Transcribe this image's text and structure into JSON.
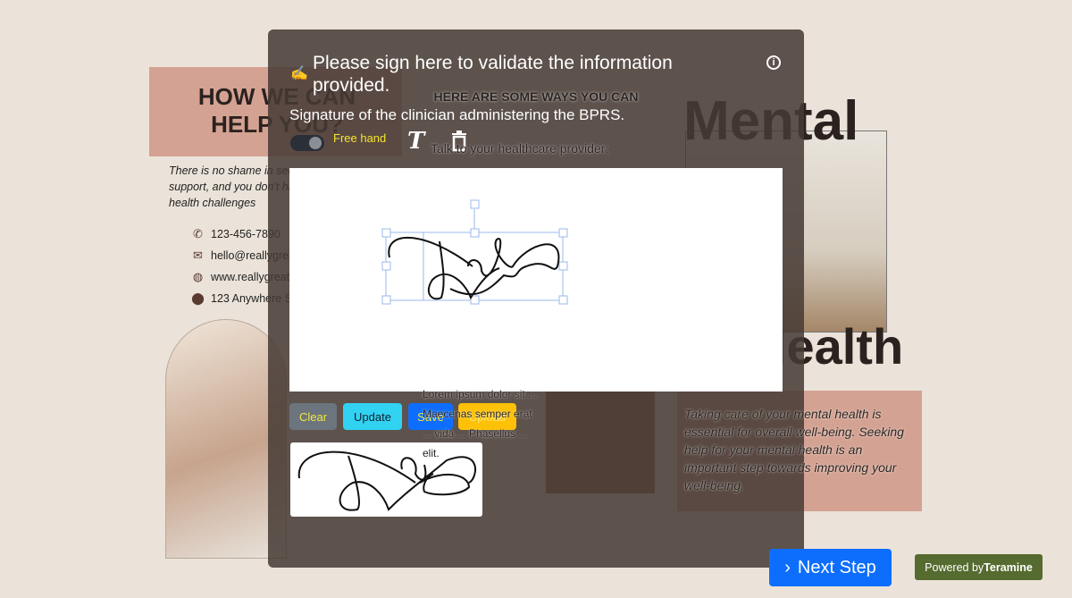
{
  "background": {
    "how_title": "HOW WE CAN HELP YOU?",
    "shame_text": "There is no shame in seeking help and support, and you don't have to face mental health challenges",
    "contacts": [
      {
        "icon": "phone-icon",
        "text": "123-456-7890"
      },
      {
        "icon": "mail-icon",
        "text": "hello@reallygreatsite.com"
      },
      {
        "icon": "globe-icon",
        "text": "www.reallygreatsite.com"
      },
      {
        "icon": "location-icon",
        "text": "123 Anywhere St."
      }
    ],
    "ways_title": "HERE ARE SOME WAYS YOU CAN",
    "talk": "Talk to your healthcare provider:",
    "lorem": "Lorem ipsum dolor sit ... Maecenas semper erat ... vida ... Phasellus ... elit.",
    "mental": "Mental",
    "health": "Health",
    "care_text": "Taking care of your mental health is essential for overall well-being. Seeking help for your mental health is an important step towards improving your well-being."
  },
  "modal": {
    "title": "Please sign here to validate the information provided.",
    "subtitle": "Signature of the clinician administering the BPRS.",
    "toggle_label": "Free hand",
    "toggle_on": true,
    "buttons": {
      "clear": "Clear",
      "update": "Update",
      "save": "Save",
      "upload": "Upload"
    }
  },
  "footer": {
    "next": "Next Step",
    "powered_prefix": "Powered by",
    "powered_brand": "Teramine"
  },
  "colors": {
    "primary": "#0d6efd",
    "info": "#31d2f2",
    "warning": "#ffc107",
    "secondary": "#6c757d",
    "brand": "#556b2f"
  }
}
